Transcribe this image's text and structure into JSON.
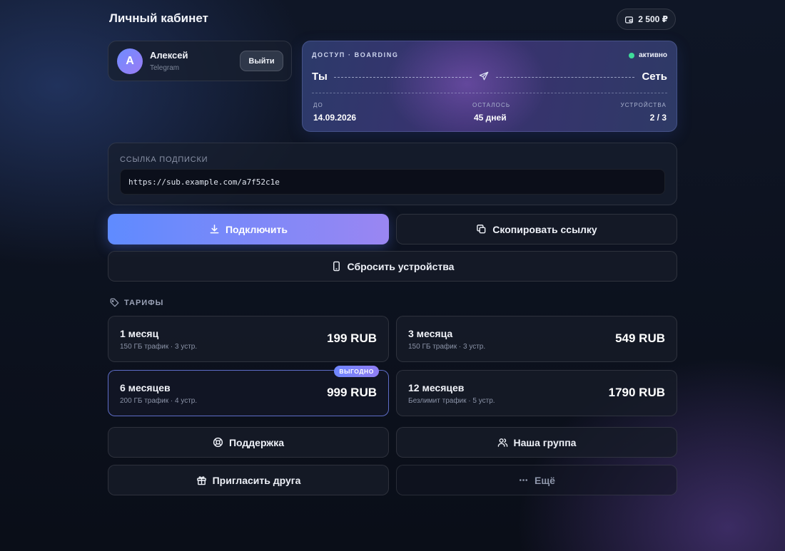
{
  "header": {
    "title": "Личный кабинет",
    "balance": "2 500 ₽",
    "balance_icon": "wallet-icon"
  },
  "profile": {
    "avatar_letter": "А",
    "name": "Алексей",
    "provider": "Telegram",
    "logout_label": "Выйти"
  },
  "access": {
    "label": "ДОСТУП · BOARDING",
    "status": "активно",
    "status_color": "#3fdc9a",
    "from": "Ты",
    "to": "Сеть",
    "until_label": "ДО",
    "until_value": "14.09.2026",
    "remaining_label": "ОСТАЛОСЬ",
    "remaining_value": "45 дней",
    "devices_label": "УСТРОЙСТВА",
    "devices_value": "2 / 3"
  },
  "subscription": {
    "label": "ССЫЛКА ПОДПИСКИ",
    "url": "https://sub.example.com/a7f52c1e"
  },
  "actions": {
    "connect": "Подключить",
    "copy": "Скопировать ссылку",
    "reset": "Сбросить устройства"
  },
  "tariffs": {
    "label": "ТАРИФЫ",
    "items": [
      {
        "name": "1 месяц",
        "desc": "150 ГБ трафик · 3 устр.",
        "price": "199 RUB"
      },
      {
        "name": "3 месяца",
        "desc": "150 ГБ трафик · 3 устр.",
        "price": "549 RUB"
      },
      {
        "name": "6 месяцев",
        "desc": "200 ГБ трафик · 4 устр.",
        "price": "999 RUB",
        "badge": "ВЫГОДНО"
      },
      {
        "name": "12 месяцев",
        "desc": "Безлимит трафик · 5 устр.",
        "price": "1790 RUB"
      }
    ]
  },
  "footer_buttons": {
    "support": "Поддержка",
    "group": "Наша группа",
    "invite": "Пригласить друга",
    "more": "Ещё"
  },
  "colors": {
    "accent_start": "#5f8bff",
    "accent_end": "#9a86f2",
    "background": "#0a0e18"
  }
}
